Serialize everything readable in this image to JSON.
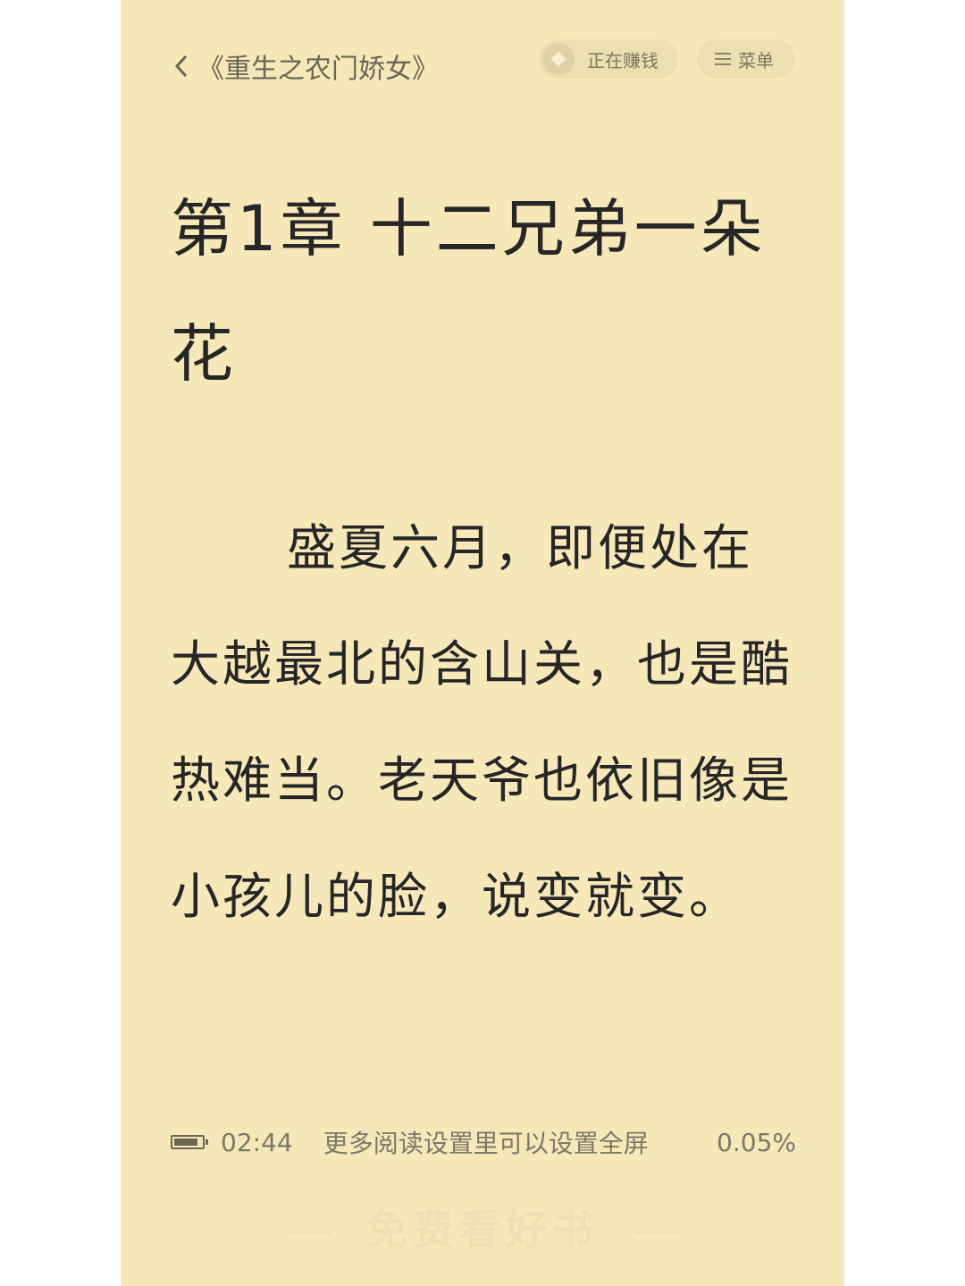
{
  "header": {
    "book_title": "《重生之农门娇女》",
    "earn_label": "正在赚钱",
    "menu_label": "菜单"
  },
  "chapter": {
    "title": "第1章 十二兄弟一朵花",
    "paragraph": "盛夏六月，即便处在大越最北的含山关，也是酷热难当。老天爷也依旧像是小孩儿的脸，说变就变。"
  },
  "status_bar": {
    "battery_level": 0.85,
    "time": "02:44",
    "tip": "更多阅读设置里可以设置全屏",
    "progress": "0.05%"
  },
  "watermark": {
    "text": "免费看好书"
  },
  "colors": {
    "page_background": "#f6e8b9",
    "text": "#262626",
    "secondary_text": "#7d7866"
  }
}
